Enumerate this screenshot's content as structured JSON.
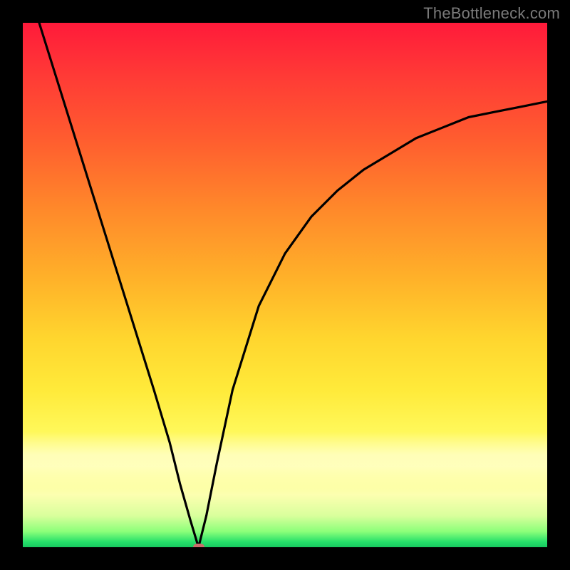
{
  "watermark": {
    "text": "TheBottleneck.com"
  },
  "chart_data": {
    "type": "line",
    "title": "",
    "xlabel": "",
    "ylabel": "",
    "xlim": [
      0,
      100
    ],
    "ylim": [
      0,
      100
    ],
    "grid": false,
    "background_gradient": {
      "stops": [
        {
          "t": 0.0,
          "color": "#ff1a3a"
        },
        {
          "t": 0.5,
          "color": "#ffb229"
        },
        {
          "t": 0.8,
          "color": "#ffff8a"
        },
        {
          "t": 0.97,
          "color": "#8cff7a"
        },
        {
          "t": 1.0,
          "color": "#18c860"
        }
      ]
    },
    "series": [
      {
        "name": "bottleneck-curve",
        "color": "#000000",
        "x": [
          0,
          5,
          10,
          15,
          20,
          25,
          28,
          30,
          32,
          33.5,
          35,
          37,
          40,
          45,
          50,
          55,
          60,
          65,
          70,
          75,
          80,
          85,
          90,
          95,
          100
        ],
        "y": [
          110,
          94,
          78,
          62,
          46,
          30,
          20,
          12,
          5,
          0,
          6,
          16,
          30,
          46,
          56,
          63,
          68,
          72,
          75,
          78,
          80,
          82,
          83,
          84,
          85
        ]
      }
    ],
    "annotations": [
      {
        "name": "minimum-marker",
        "x": 33.5,
        "y": 0,
        "color": "#cc6b6b",
        "shape": "pill"
      }
    ]
  }
}
